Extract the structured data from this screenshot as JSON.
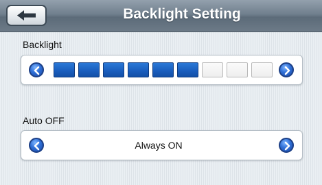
{
  "header": {
    "title": "Backlight Setting",
    "back_icon": "back-arrow-icon"
  },
  "backlight": {
    "label": "Backlight",
    "level": 6,
    "max_level": 9,
    "active_color": "#1a5fbf"
  },
  "auto_off": {
    "label": "Auto OFF",
    "value": "Always ON"
  }
}
